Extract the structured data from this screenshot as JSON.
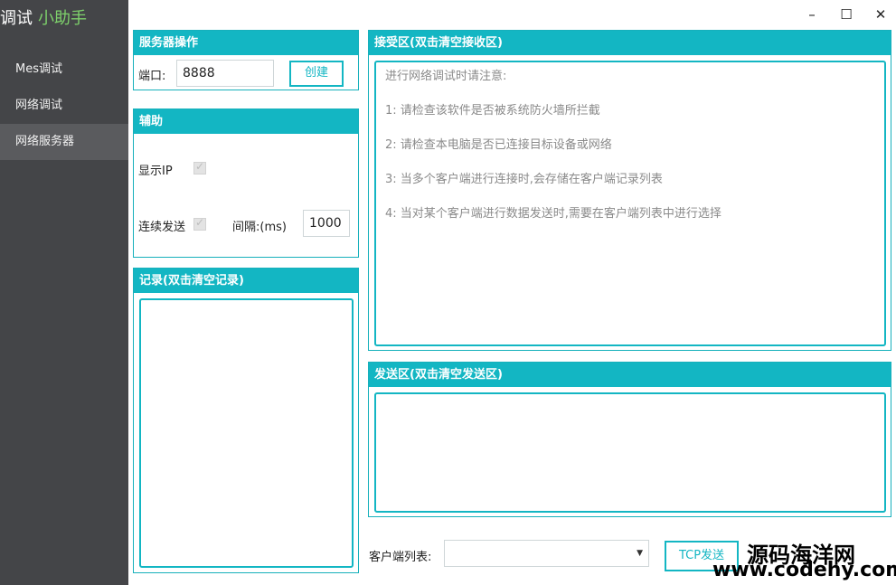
{
  "app": {
    "title_part1": "调试",
    "title_part2": "小助手"
  },
  "sidebar": {
    "items": [
      {
        "label": "Mes调试"
      },
      {
        "label": "网络调试"
      },
      {
        "label": "网络服务器"
      }
    ]
  },
  "window": {
    "minimize": "–",
    "maximize": "☐",
    "close": "✕"
  },
  "server_ops": {
    "title": "服务器操作",
    "port_label": "端口:",
    "port_value": "8888",
    "create_button": "创建"
  },
  "aux": {
    "title": "辅助",
    "show_ip_label": "显示IP",
    "continuous_send_label": "连续发送",
    "interval_label": "间隔:(ms)",
    "interval_value": "1000"
  },
  "log": {
    "title": "记录(双击清空记录)"
  },
  "receive": {
    "title": "接受区(双击清空接收区)",
    "lines": [
      "进行网络调试时请注意:",
      "1: 请检查该软件是否被系统防火墙所拦截",
      "2: 请检查本电脑是否已连接目标设备或网络",
      "3: 当多个客户端进行连接时,会存储在客户端记录列表",
      "4: 当对某个客户端进行数据发送时,需要在客户端列表中进行选择"
    ]
  },
  "send": {
    "title": "发送区(双击清空发送区)"
  },
  "bottom": {
    "client_list_label": "客户端列表:",
    "client_selected": "",
    "tcp_send_button": "TCP发送"
  },
  "watermark": {
    "line1": "源码海洋网",
    "line2": "www.codehy.com"
  },
  "colors": {
    "accent": "#13b6c3",
    "sidebar_bg": "#444548",
    "title_accent": "#7ed16b"
  }
}
